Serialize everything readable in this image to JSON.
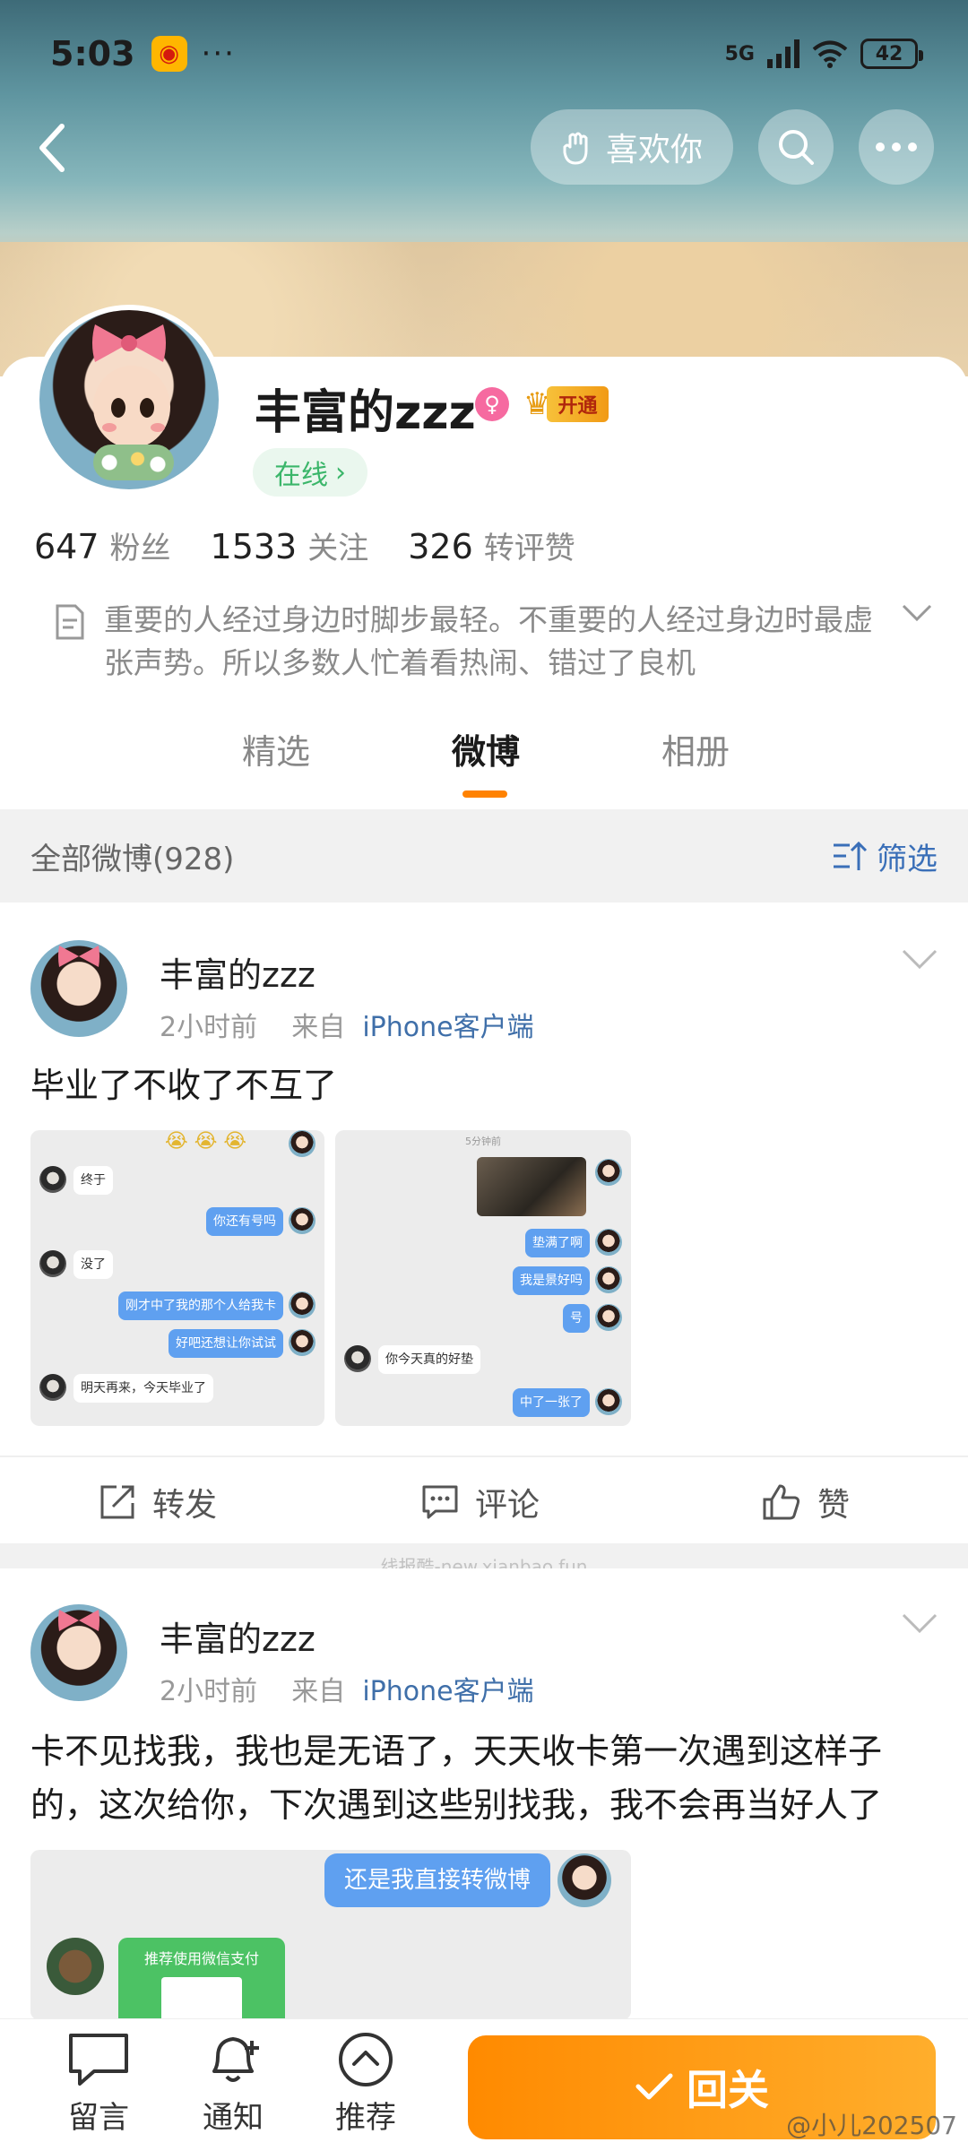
{
  "status_bar": {
    "time": "5:03",
    "dots": "···",
    "network": "5G",
    "battery": "42"
  },
  "header": {
    "like_label": "喜欢你"
  },
  "profile": {
    "name": "丰富的zzz",
    "vip_label": "开通",
    "online_label": "在线",
    "stats": [
      {
        "num": "647",
        "label": "粉丝"
      },
      {
        "num": "1533",
        "label": "关注"
      },
      {
        "num": "326",
        "label": "转评赞"
      }
    ],
    "bio": "重要的人经过身边时脚步最轻。不重要的人经过身边时最虚张声势。所以多数人忙着看热闹、错过了良机"
  },
  "tabs": [
    "精选",
    "微博",
    "相册"
  ],
  "active_tab": "微博",
  "filter": {
    "all_label": "全部微博(928)",
    "filter_label": "筛选"
  },
  "posts": [
    {
      "author": "丰富的zzz",
      "time": "2小时前",
      "from_prefix": "来自",
      "source": "iPhone客户端",
      "text": "毕业了不收了不互了",
      "shot1": {
        "bubbles": [
          "终于",
          "你还有号吗",
          "没了",
          "刚才中了我的那个人给我卡",
          "好吧还想让你试试",
          "明天再来，今天毕业了"
        ]
      },
      "shot2": {
        "time": "5分钟前",
        "bubbles": [
          "垫满了啊",
          "我是景好吗",
          "号",
          "你今天真的好垫",
          "中了一张了"
        ]
      }
    },
    {
      "author": "丰富的zzz",
      "time": "2小时前",
      "from_prefix": "来自",
      "source": "iPhone客户端",
      "text": "卡不见找我，我也是无语了，天天收卡第一次遇到这样子的，这次给你，下次遇到这些别找我，我不会再当好人了",
      "shot": {
        "bubble": "还是我直接转微博",
        "card_title": "推荐使用微信支付"
      }
    }
  ],
  "actions": {
    "repost": "转发",
    "comment": "评论",
    "like": "赞"
  },
  "watermark": "线报酷-new.xianbao.fun",
  "bottom": {
    "message": "留言",
    "notify": "通知",
    "recommend": "推荐",
    "follow_back": "回关"
  },
  "signature": "@小儿202507"
}
